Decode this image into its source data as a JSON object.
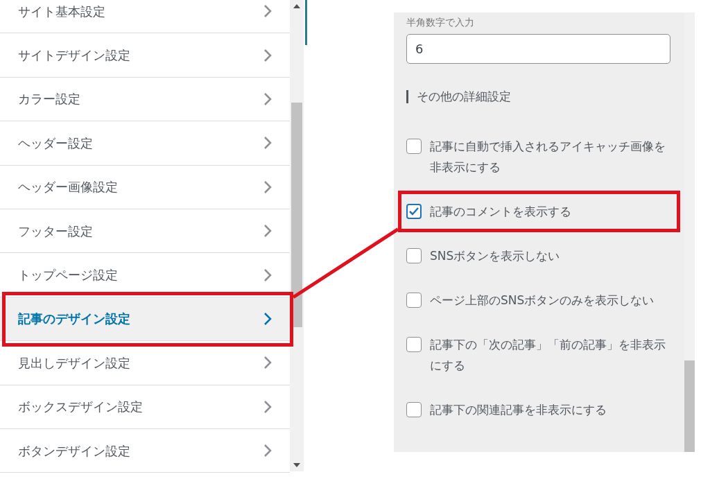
{
  "menu": {
    "items": [
      {
        "label": "サイト基本設定",
        "selected": false,
        "highlighted": false
      },
      {
        "label": "サイトデザイン設定",
        "selected": false,
        "highlighted": false
      },
      {
        "label": "カラー設定",
        "selected": false,
        "highlighted": false
      },
      {
        "label": "ヘッダー設定",
        "selected": false,
        "highlighted": false
      },
      {
        "label": "ヘッダー画像設定",
        "selected": false,
        "highlighted": false
      },
      {
        "label": "フッター設定",
        "selected": false,
        "highlighted": false
      },
      {
        "label": "トップページ設定",
        "selected": false,
        "highlighted": false
      },
      {
        "label": "記事のデザイン設定",
        "selected": true,
        "highlighted": true
      },
      {
        "label": "見出しデザイン設定",
        "selected": false,
        "highlighted": false
      },
      {
        "label": "ボックスデザイン設定",
        "selected": false,
        "highlighted": false
      },
      {
        "label": "ボタンデザイン設定",
        "selected": false,
        "highlighted": false
      }
    ]
  },
  "settings": {
    "field": {
      "label": "半角数字で入力",
      "value": "6"
    },
    "section_title": "その他の詳細設定",
    "options": [
      {
        "label": "記事に自動で挿入されるアイキャッチ画像を非表示にする",
        "checked": false,
        "highlighted": false
      },
      {
        "label": "記事のコメントを表示する",
        "checked": true,
        "highlighted": true
      },
      {
        "label": "SNSボタンを表示しない",
        "checked": false,
        "highlighted": false
      },
      {
        "label": "ページ上部のSNSボタンのみを表示しない",
        "checked": false,
        "highlighted": false
      },
      {
        "label": "記事下の「次の記事」「前の記事」を非表示にする",
        "checked": false,
        "highlighted": false
      },
      {
        "label": "記事下の関連記事を非表示にする",
        "checked": false,
        "highlighted": false
      }
    ]
  }
}
